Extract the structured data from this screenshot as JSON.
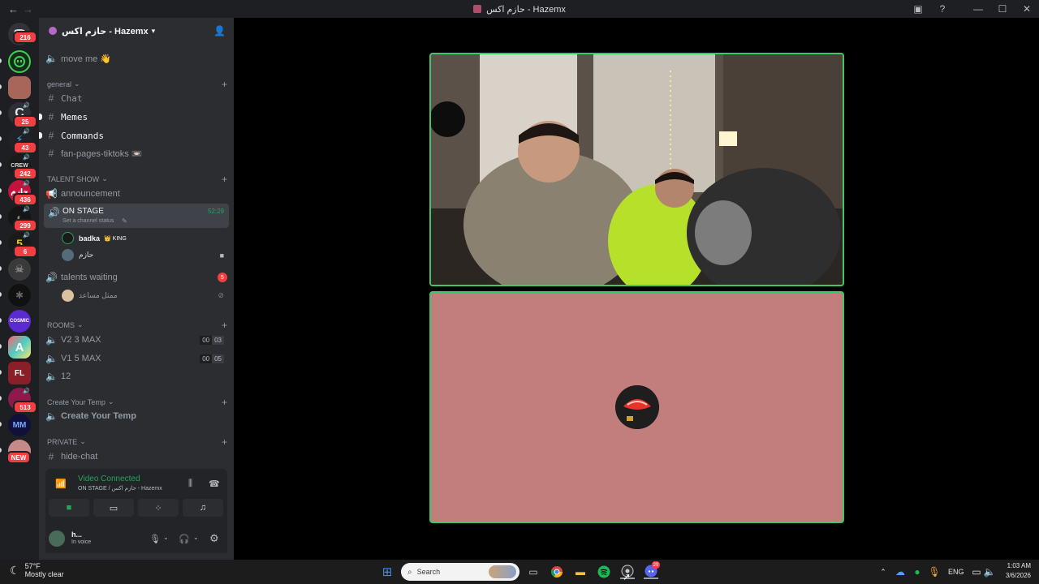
{
  "window": {
    "title": "حازم اكس - Hazemx"
  },
  "rail": {
    "badges": [
      "216",
      "25",
      "43",
      "242",
      "436",
      "299",
      "6",
      "513",
      "NEW"
    ],
    "server_labels": [
      "5"
    ]
  },
  "guild": {
    "name": "حازم اكس - Hazemx"
  },
  "channels": {
    "move_me": "move me 👋",
    "cat_general": "general",
    "chat": "Chat",
    "memes": "Memes",
    "commands": "Commands",
    "fan_pages": "fan-pages-tiktoks 📼",
    "cat_talent": "TALENT SHOW",
    "announcement": "announcement",
    "on_stage": "ON STAGE",
    "on_stage_status": "Set a channel status",
    "on_stage_time": "52:29",
    "stage_users": [
      {
        "name": "badka",
        "tag": "👑 KING"
      },
      {
        "name": "حازم"
      }
    ],
    "talents_waiting": "talents waiting",
    "talents_badge": "5",
    "waiting_user": "ممثل مساعد",
    "cat_rooms": "ROOMS",
    "room1": "V2 3 MAX",
    "room1_lim": [
      "00",
      "03"
    ],
    "room2": "V1 5 MAX",
    "room2_lim": [
      "00",
      "05"
    ],
    "room3": "12",
    "cat_temp": "Create Your Temp",
    "create_temp": "Create Your Temp",
    "cat_private": "PRIVATE",
    "hide_chat": "hide-chat"
  },
  "voice": {
    "status": "Video Connected",
    "sub": "ON STAGE / حازم اكس - Hazemx"
  },
  "user": {
    "name": "h...",
    "status": "In voice"
  },
  "taskbar": {
    "temp": "57°F",
    "weather": "Mostly clear",
    "search_placeholder": "Search",
    "lang": "ENG",
    "time": "1:03 AM",
    "date": "3/6/2026",
    "discord_badge": "29"
  },
  "colors": {
    "accent": "#3cc868",
    "tile_bg": "#c27e7c",
    "sidebar": "#2b2d31",
    "rail": "#1e1f22"
  }
}
